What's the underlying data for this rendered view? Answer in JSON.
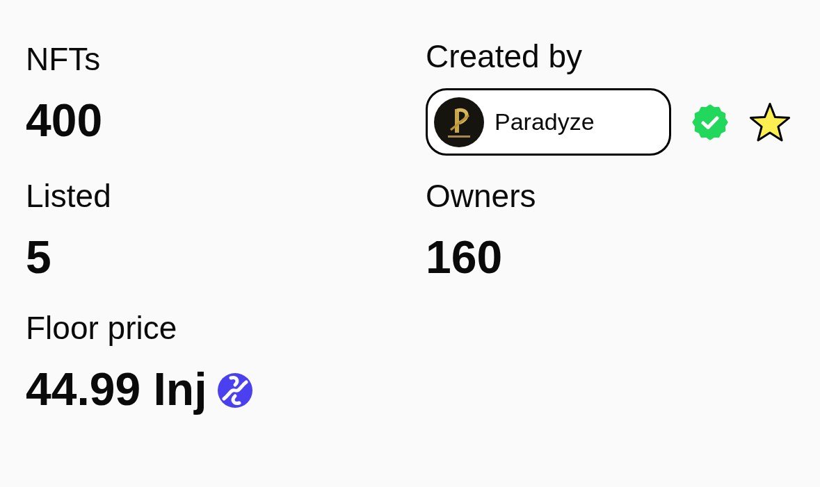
{
  "stats": [
    {
      "kind": "count",
      "label": "NFTs",
      "value": "400"
    },
    {
      "kind": "count",
      "label": "Listed",
      "value": "5"
    },
    {
      "kind": "price",
      "label": "Floor price",
      "value": "44.99 Inj"
    }
  ],
  "creator": {
    "label": "Created by",
    "name": "Paradyze",
    "verified": true,
    "favorited": true
  },
  "owners": {
    "label": "Owners",
    "value": "160"
  }
}
